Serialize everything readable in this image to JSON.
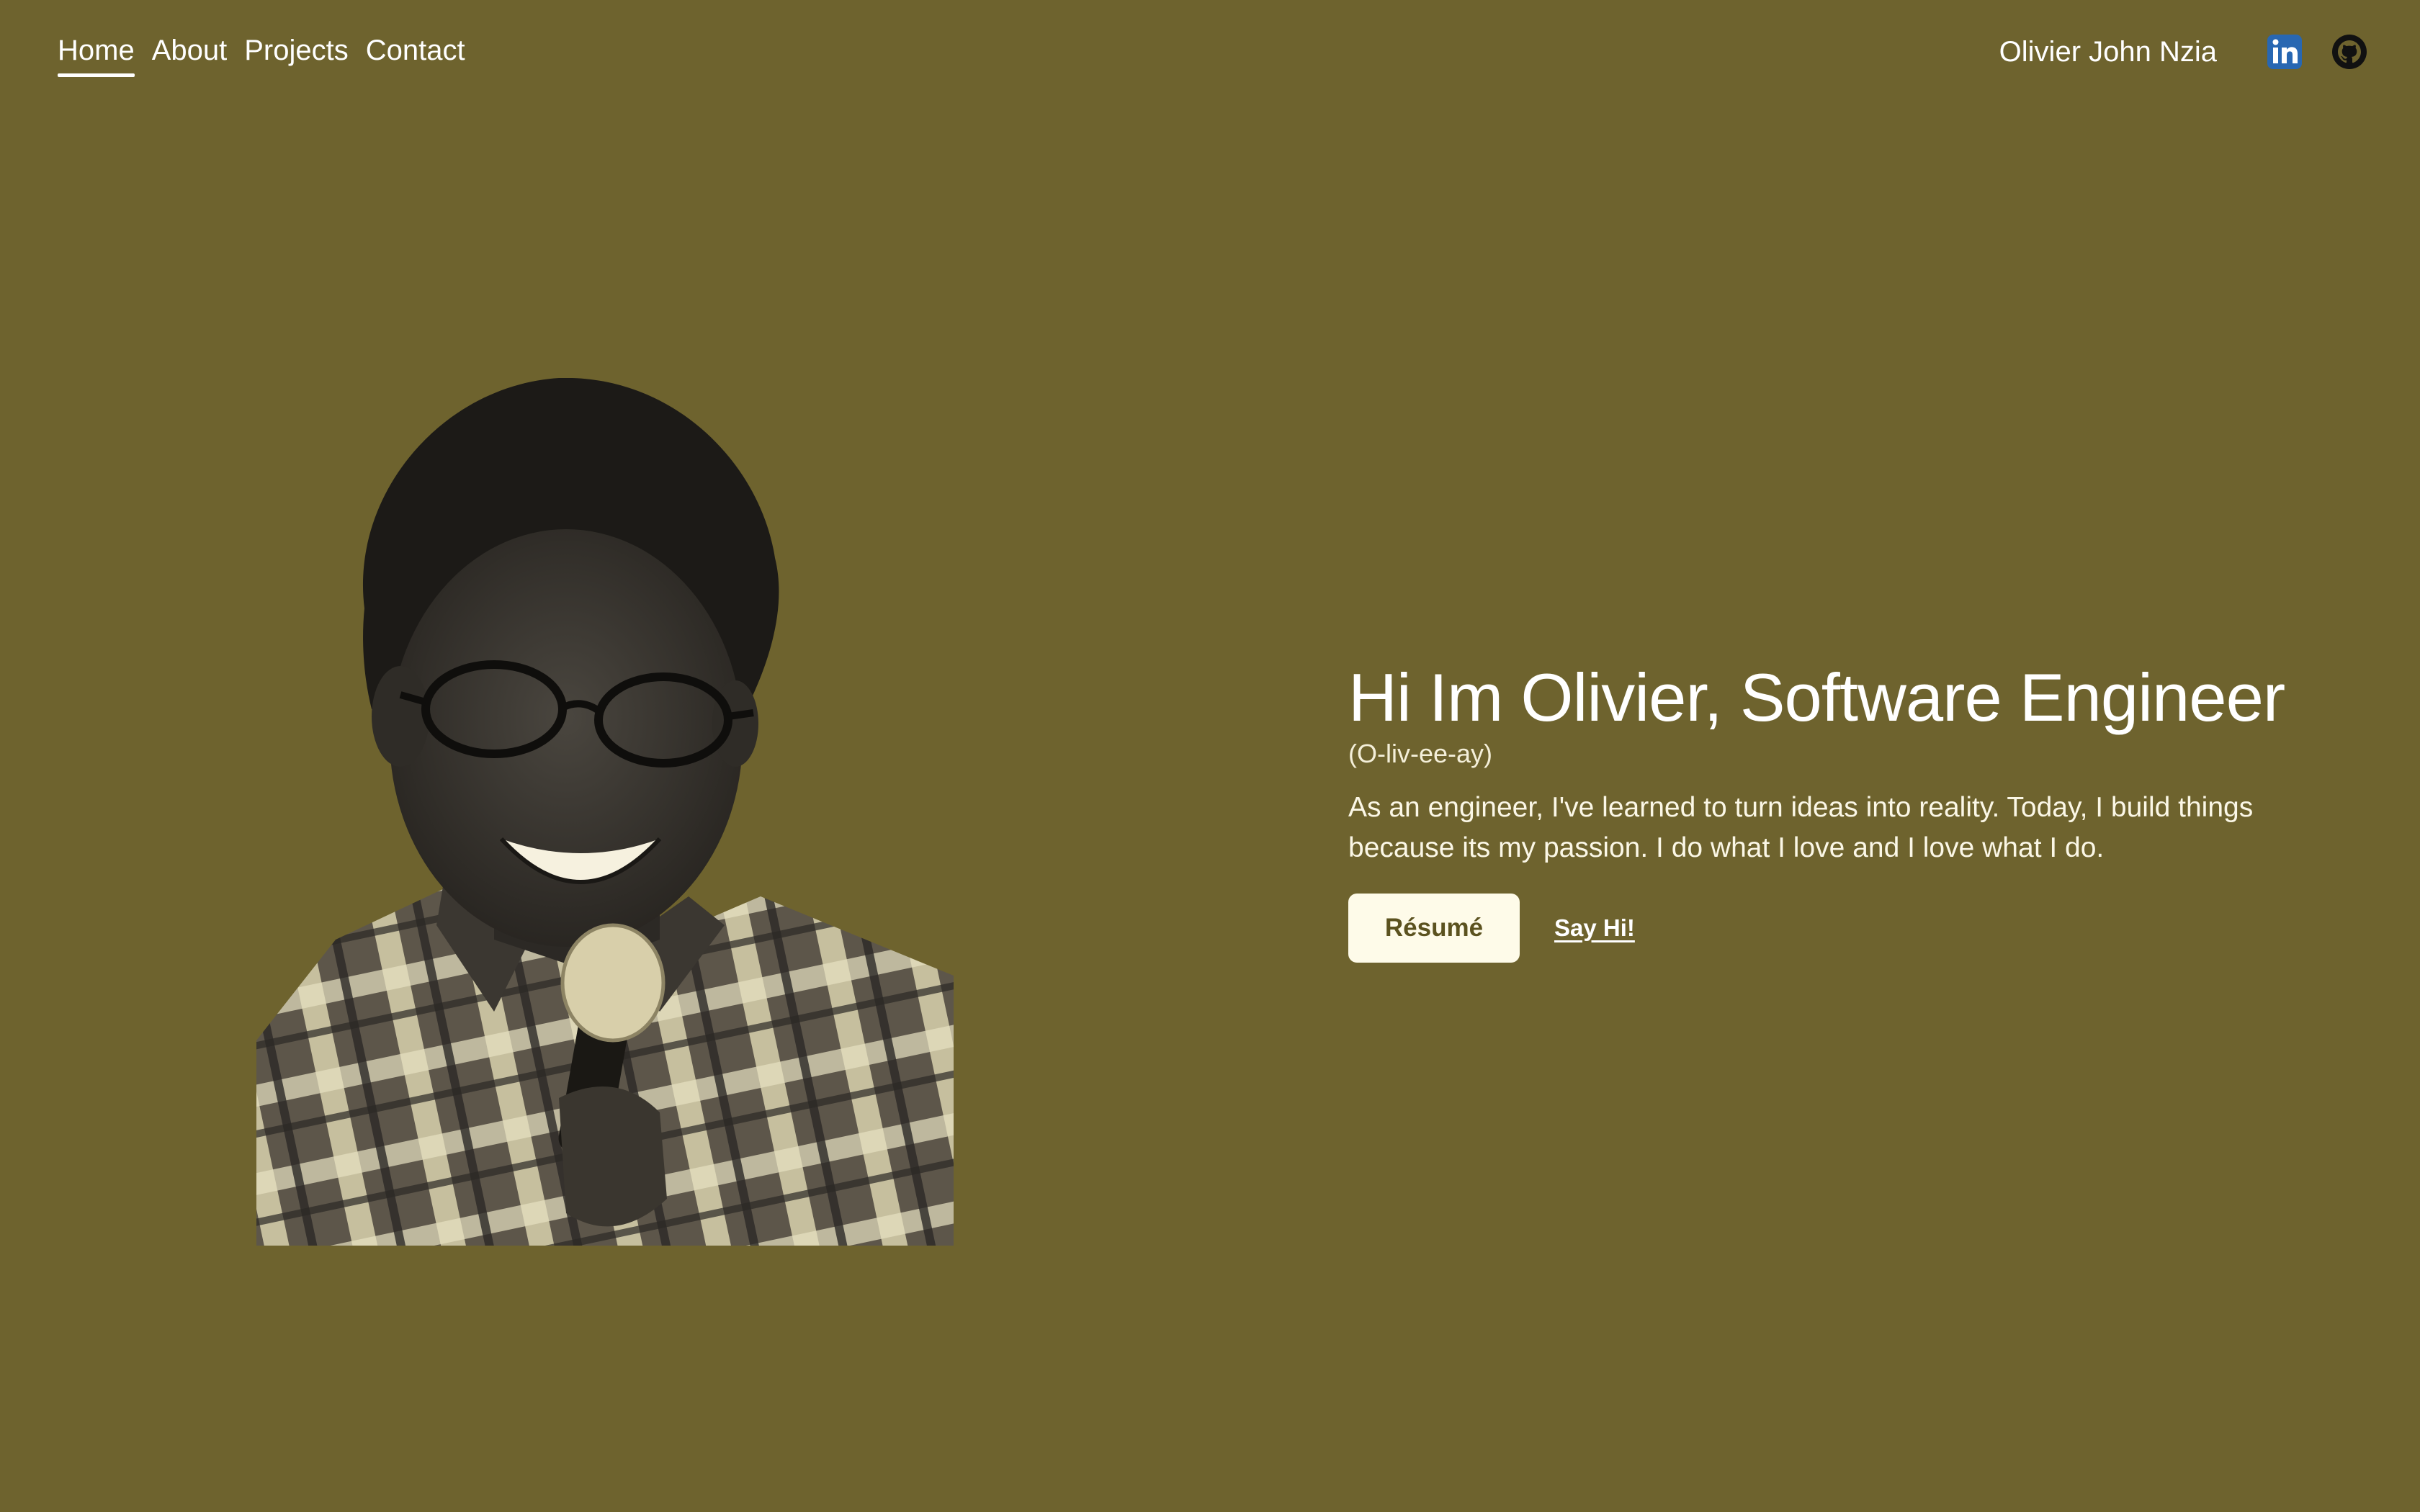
{
  "nav": {
    "items": [
      {
        "label": "Home",
        "active": true
      },
      {
        "label": "About",
        "active": false
      },
      {
        "label": "Projects",
        "active": false
      },
      {
        "label": "Contact",
        "active": false
      }
    ]
  },
  "header": {
    "brand": "Olivier John Nzia",
    "social": [
      {
        "icon": "linkedin-icon",
        "color": "#2867b2"
      },
      {
        "icon": "github-icon",
        "color": "#111111"
      }
    ]
  },
  "hero": {
    "title": "Hi Im Olivier, Software Engineer",
    "pronunciation": "(O-liv-ee-ay)",
    "lead": "As an engineer, I've learned to turn ideas into reality. Today, I build things because its my passion. I do what I love and I love what I do.",
    "resume_label": "Résumé",
    "sayhi_label": "Say Hi!"
  },
  "colors": {
    "background": "#6e632e",
    "button_bg": "#fefbe9",
    "button_text": "#5b521f"
  }
}
